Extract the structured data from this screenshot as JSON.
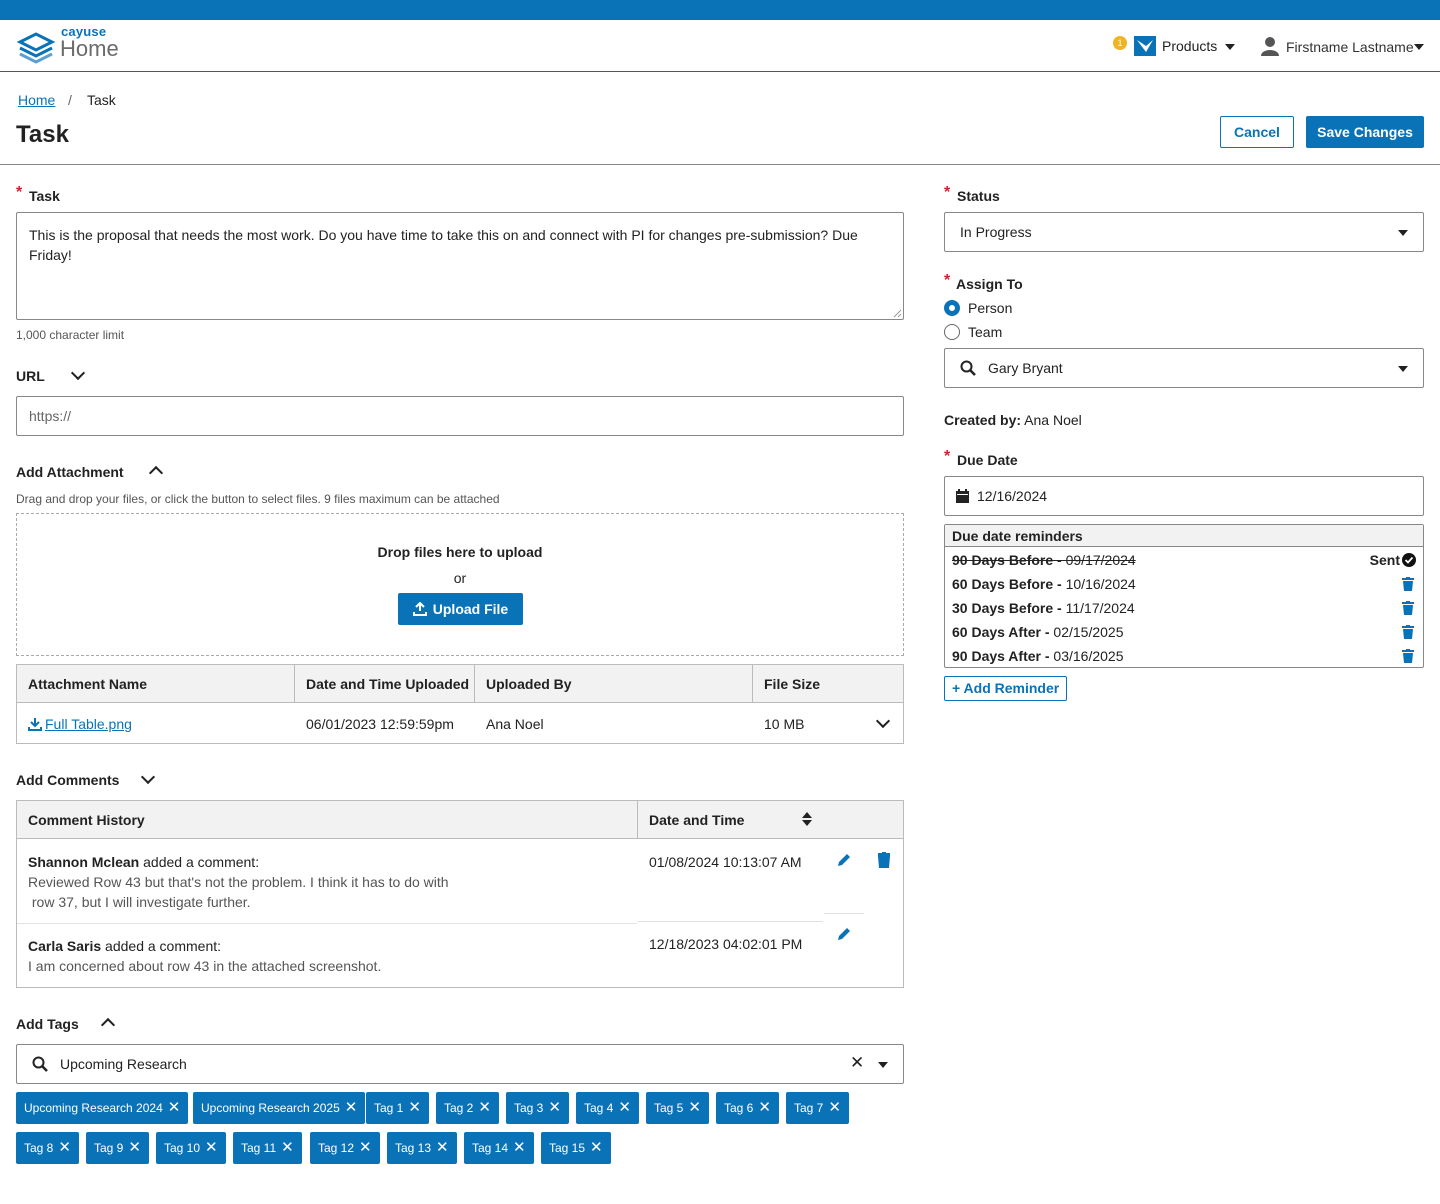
{
  "header": {
    "brand_small": "cayuse",
    "brand_home": "Home",
    "notification_count": "1",
    "products_label": "Products",
    "user_label": "Firstname Lastname"
  },
  "breadcrumb": {
    "home": "Home",
    "separator": "/",
    "current": "Task"
  },
  "page": {
    "title": "Task",
    "cancel": "Cancel",
    "save": "Save Changes"
  },
  "task": {
    "label": "Task",
    "value": "This is the proposal that needs the most work. Do you have time to take this on and connect with PI for changes pre-submission? Due Friday!",
    "limit": "1,000 character limit"
  },
  "url": {
    "label": "URL",
    "placeholder": "https://"
  },
  "attachment": {
    "label": "Add Attachment",
    "help": "Drag and drop your files, or click the button to select files. 9 files maximum can be attached",
    "drop": "Drop files here to upload",
    "or": "or",
    "upload": "Upload File",
    "columns": [
      "Attachment Name",
      "Date and Time Uploaded",
      "Uploaded By",
      "File Size"
    ],
    "rows": [
      {
        "name": "Full Table.png",
        "date": "06/01/2023 12:59:59pm",
        "by": "Ana Noel",
        "size": "10 MB"
      }
    ]
  },
  "comments": {
    "label": "Add Comments",
    "columns": [
      "Comment History",
      "Date and Time"
    ],
    "rows": [
      {
        "author": "Shannon Mclean",
        "action": " added a comment:",
        "text1": "Reviewed Row 43 but that's not the problem. I think it has to do with",
        "text2": " row 37, but I will investigate further.",
        "date": "01/08/2024 10:13:07 AM"
      },
      {
        "author": "Carla Saris",
        "action": " added a comment:",
        "text1": "I am concerned about row 43 in the attached screenshot.",
        "text2": "",
        "date": "12/18/2023 04:02:01 PM"
      }
    ]
  },
  "tags": {
    "label": "Add Tags",
    "search_value": "Upcoming Research",
    "items_row1": [
      "Upcoming Research 2024",
      "Upcoming Research 2025",
      "Tag 1",
      "Tag 2",
      "Tag 3",
      "Tag 4",
      "Tag 5",
      "Tag 6",
      "Tag 7"
    ],
    "items_row2": [
      "Tag 8",
      "Tag 9",
      "Tag 10",
      "Tag 11",
      "Tag 12",
      "Tag 13",
      "Tag 14",
      "Tag 15"
    ]
  },
  "status": {
    "label": "Status",
    "value": "In Progress"
  },
  "assign": {
    "label": "Assign To",
    "option_person": "Person",
    "option_team": "Team",
    "selected": "Person",
    "value": "Gary Bryant"
  },
  "created": {
    "label": "Created by:",
    "value": "Ana Noel"
  },
  "due": {
    "label": "Due Date",
    "value": "12/16/2024"
  },
  "reminders": {
    "title": "Due date reminders",
    "sent_label": "Sent",
    "items": [
      {
        "label": "90 Days Before - ",
        "date": "09/17/2024",
        "sent": true
      },
      {
        "label": "60 Days Before - ",
        "date": "10/16/2024",
        "sent": false
      },
      {
        "label": "30 Days Before - ",
        "date": "11/17/2024",
        "sent": false
      },
      {
        "label": "60 Days After - ",
        "date": "02/15/2025",
        "sent": false
      },
      {
        "label": "90 Days After - ",
        "date": "03/16/2025",
        "sent": false
      }
    ],
    "add": "+ Add Reminder"
  },
  "colors": {
    "primary": "#0a73b7",
    "required": "#c0282d",
    "notification": "#f0b322"
  }
}
